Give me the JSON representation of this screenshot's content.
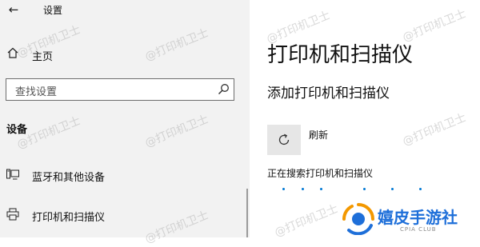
{
  "window": {
    "title": "设置",
    "back_glyph": "←"
  },
  "sidebar": {
    "home_label": "主页",
    "search_placeholder": "查找设置",
    "section_title": "设备",
    "items": [
      {
        "label": "蓝牙和其他设备",
        "icon": "bluetooth-devices-icon"
      },
      {
        "label": "打印机和扫描仪",
        "icon": "printer-icon"
      }
    ]
  },
  "main": {
    "title": "打印机和扫描仪",
    "add_heading": "添加打印机和扫描仪",
    "refresh_label": "刷新",
    "status": "正在搜索打印机和扫描仪"
  },
  "watermark": "@打印机卫士",
  "logo": {
    "name": "嬉皮手游社",
    "sub": "CPIA CLUB"
  },
  "colors": {
    "accent": "#0078d4",
    "sidebar_bg": "#f2f2f2",
    "logo_orange": "#f39800",
    "logo_blue": "#1e6fd9"
  }
}
